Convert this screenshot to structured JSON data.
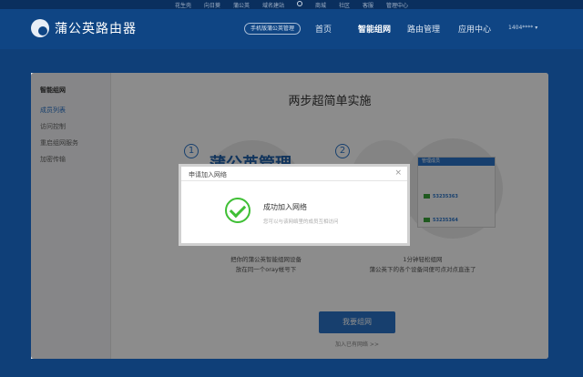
{
  "topbar": {
    "links": [
      "花生壳",
      "向日葵",
      "蒲公英",
      "域名建站",
      "商城",
      "社区",
      "客服",
      "管理中心"
    ]
  },
  "header": {
    "brand": "蒲公英路由器",
    "mobile_mgmt": "手机版蒲公英管理",
    "nav": [
      {
        "label": "首页"
      },
      {
        "label": "智能组网"
      },
      {
        "label": "路由管理"
      },
      {
        "label": "应用中心"
      }
    ],
    "account": "1404****"
  },
  "sidebar": {
    "title": "智能组网",
    "items": [
      {
        "label": "成员列表"
      },
      {
        "label": "访问控制"
      },
      {
        "label": "重启组网服务"
      },
      {
        "label": "加密传输"
      }
    ]
  },
  "main": {
    "heading": "两步超简单实施",
    "step1": {
      "number": "1",
      "big_text": "蒲公英管理",
      "desc_line1": "把你的蒲公英智能组网设备",
      "desc_line2": "放在同一个oray帐号下"
    },
    "step2": {
      "number": "2",
      "panel_title": "管理成员",
      "rows": [
        {
          "id": "53235363"
        },
        {
          "id": "53235364"
        }
      ],
      "desc_line1": "1分钟轻松组网",
      "desc_line2": "蒲公英下的各个设备间便可点对点直连了"
    },
    "join_button": "我要组网",
    "joined_link": "加入已有网络 >>"
  },
  "dialog": {
    "title": "申请加入网络",
    "close": "×",
    "message": "成功加入网络",
    "sub_message": "您可以与该网络里的成员互相访问"
  },
  "colors": {
    "brand_blue": "#0f4584",
    "accent_blue": "#2a74c8",
    "success_green": "#3fbf35"
  }
}
